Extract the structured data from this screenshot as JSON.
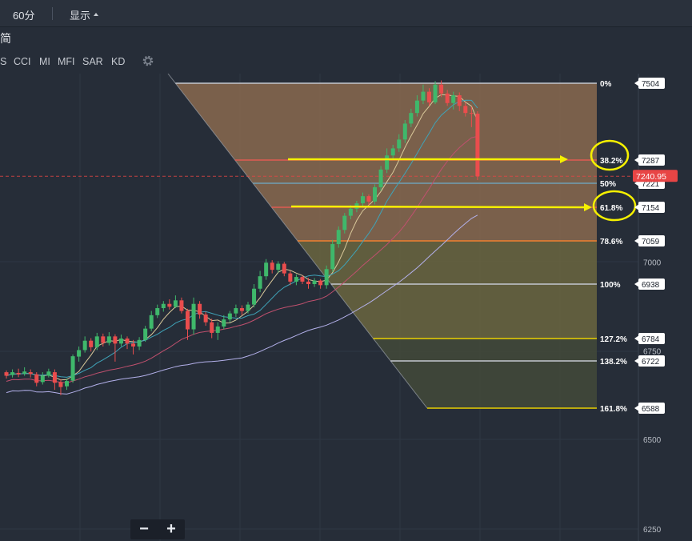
{
  "toolbar": {
    "interval": "60分",
    "display": "显示"
  },
  "title_fragment": "简",
  "indicators": [
    "S",
    "CCI",
    "MI",
    "MFI",
    "SAR",
    "KD"
  ],
  "price_axis": {
    "fib_tags": [
      "7504",
      "7287",
      "7221",
      "7154",
      "7059",
      "6938",
      "6784",
      "6722",
      "6588"
    ],
    "current_price": "7240.95",
    "ticks": [
      "7000",
      "6750",
      "6500",
      "6250"
    ]
  },
  "fib_levels": [
    {
      "label": "0%",
      "price": 7504,
      "line": "#c4c8d0"
    },
    {
      "label": "38.2%",
      "price": 7287,
      "line": "#e05a52"
    },
    {
      "label": "50%",
      "price": 7221,
      "line": "#6fa0b4"
    },
    {
      "label": "61.8%",
      "price": 7154,
      "line": "#e05a52"
    },
    {
      "label": "78.6%",
      "price": 7059,
      "line": "#f08030"
    },
    {
      "label": "100%",
      "price": 6938,
      "line": "#c4c8d0"
    },
    {
      "label": "127.2%",
      "price": 6784,
      "line": "#e8d000"
    },
    {
      "label": "138.2%",
      "price": 6722,
      "line": "#c4c8d0"
    },
    {
      "label": "161.8%",
      "price": 6588,
      "line": "#e8d000"
    }
  ],
  "colors": {
    "up": "#3fb86b",
    "down": "#ea4d4d",
    "background": "#262d38",
    "fib_upper": "#8a6a4f",
    "fib_middle": "#6b6640",
    "fib_lower": "#434a3a",
    "annotation": "#f5f000",
    "current_price_tag": "#e84545"
  },
  "zoom": {
    "minus": "−",
    "plus": "+"
  },
  "icons": {
    "settings": "gear-icon",
    "display_menu": "caret-down-icon"
  }
}
